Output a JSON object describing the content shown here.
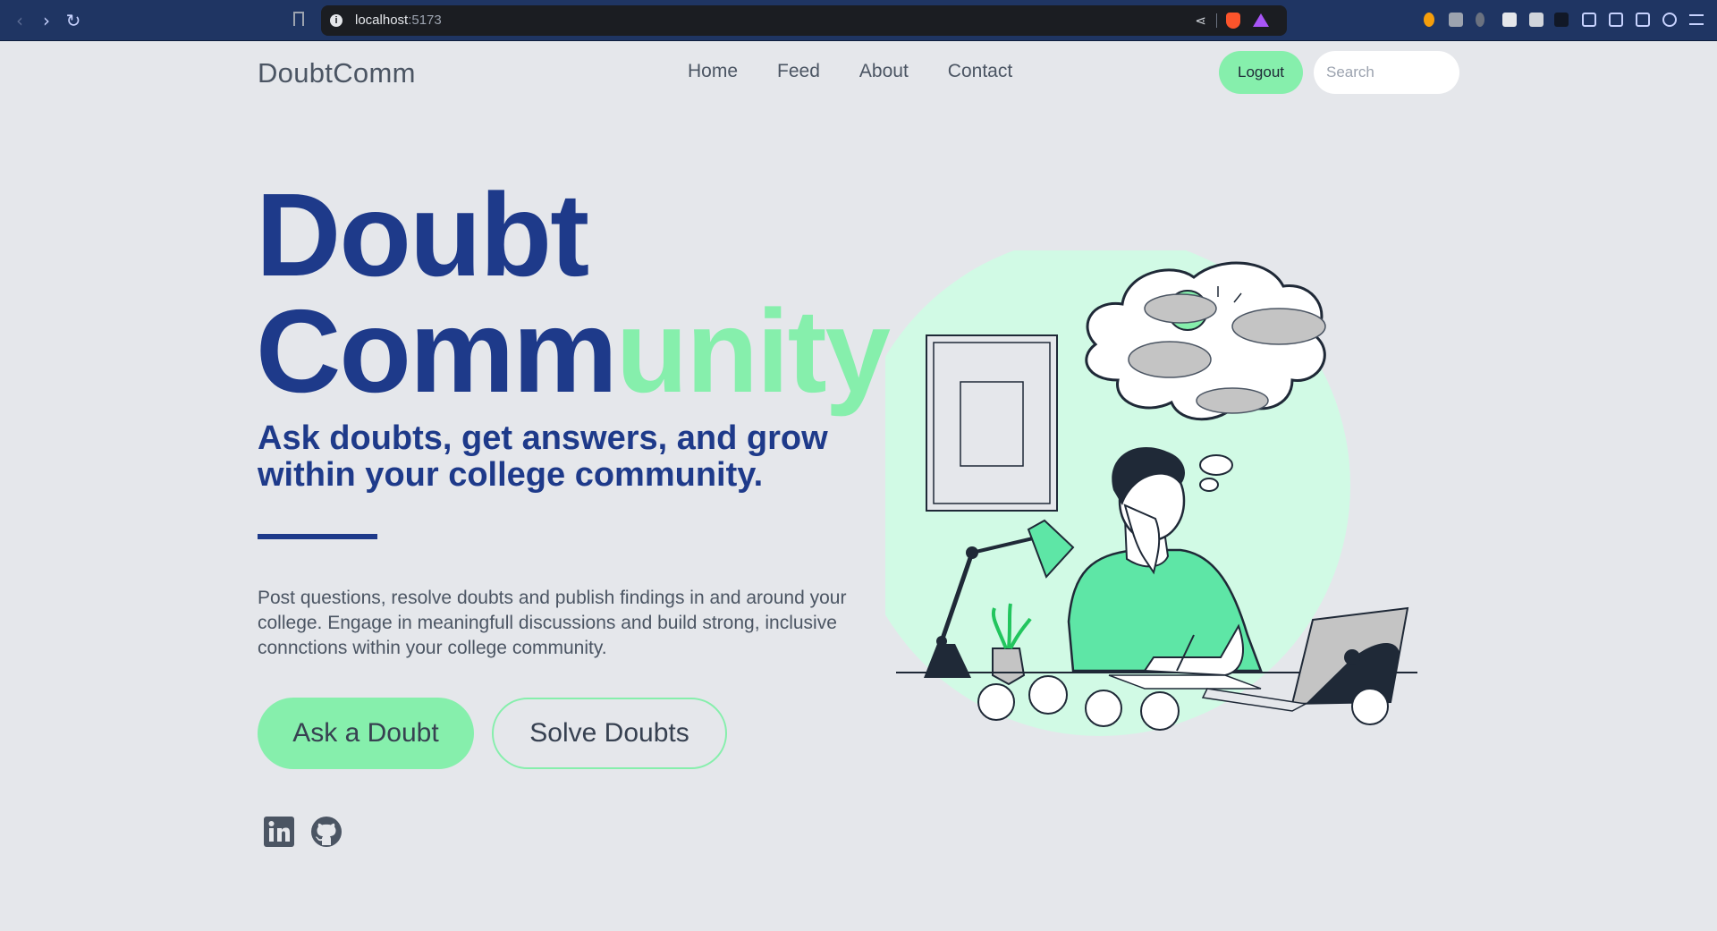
{
  "browser": {
    "url_host": "localhost",
    "url_port": ":5173"
  },
  "header": {
    "brand": "DoubtComm",
    "nav": [
      "Home",
      "Feed",
      "About",
      "Contact"
    ],
    "logout_label": "Logout",
    "search_placeholder": "Search"
  },
  "hero": {
    "title_line1": "Doubt",
    "title_line2_main": "Comm",
    "title_line2_accent": "unity",
    "tagline": "Ask doubts, get answers, and grow within your college community.",
    "description": "Post questions, resolve doubts and publish findings in and around your college. Engage in meaningfull discussions and build strong, inclusive connctions within your college community.",
    "primary_cta": "Ask a Doubt",
    "secondary_cta": "Solve Doubts"
  },
  "social": [
    "linkedin-icon",
    "github-icon"
  ],
  "colors": {
    "brand_blue": "#1e3a8a",
    "accent_green": "#86efac",
    "background": "#e5e7eb",
    "illustration_circle": "#d1fae5"
  }
}
